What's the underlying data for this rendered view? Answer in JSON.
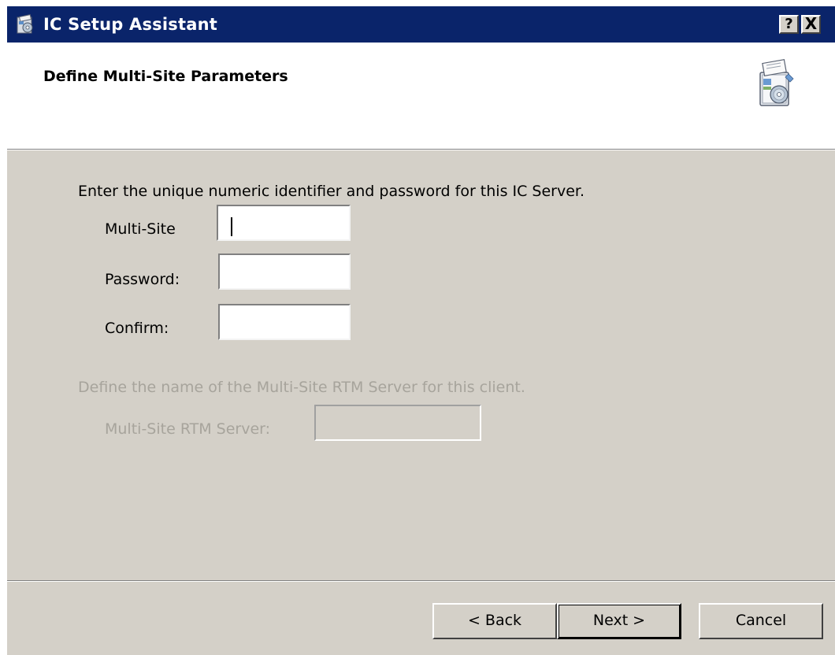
{
  "window": {
    "title": "IC Setup Assistant",
    "help_button": "?",
    "close_button": "X"
  },
  "header": {
    "heading": "Define Multi-Site Parameters"
  },
  "section1": {
    "instruction": "Enter the unique numeric identifier and password for this IC Server.",
    "fields": [
      {
        "label": "Multi-Site",
        "value": ""
      },
      {
        "label": "Password:",
        "value": ""
      },
      {
        "label": "Confirm:",
        "value": ""
      }
    ]
  },
  "section2": {
    "instruction": "Define the name of the Multi-Site RTM Server for this client.",
    "field_label": "Multi-Site RTM Server:",
    "field_value": ""
  },
  "buttons": {
    "back": "< Back",
    "next": "Next >",
    "cancel": "Cancel"
  },
  "colors": {
    "titlebar": "#0a246a",
    "dialog_bg": "#d4d0c8",
    "disabled_text": "#a7a49c"
  }
}
